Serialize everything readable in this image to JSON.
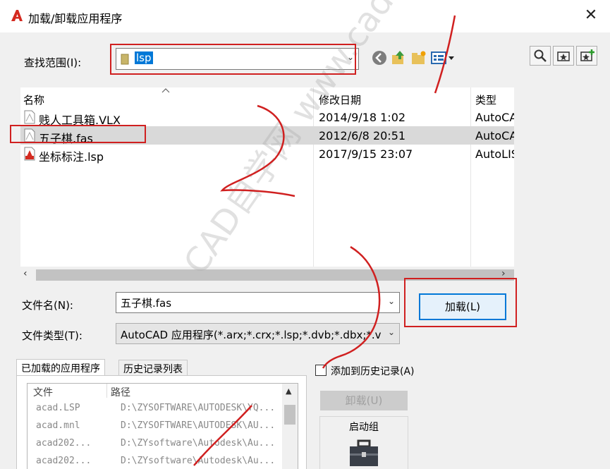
{
  "window": {
    "title": "加载/卸载应用程序",
    "close_glyph": "✕"
  },
  "lookin": {
    "label": "查找范围(I):",
    "value": "lsp"
  },
  "filelist": {
    "headers": {
      "name": "名称",
      "date": "修改日期",
      "type": "类型"
    },
    "rows": [
      {
        "name": "贱人工具箱.VLX",
        "date": "2014/9/18 1:02",
        "type": "AutoCA",
        "icon": "vlx-file-icon"
      },
      {
        "name": "五子棋.fas",
        "date": "2012/6/8 20:51",
        "type": "AutoCA",
        "icon": "fas-file-icon"
      },
      {
        "name": "坐标标注.lsp",
        "date": "2017/9/15 23:07",
        "type": "AutoLIS",
        "icon": "lsp-file-icon"
      }
    ]
  },
  "filename": {
    "label": "文件名(N):",
    "value": "五子棋.fas"
  },
  "filetype": {
    "label": "文件类型(T):",
    "value": "AutoCAD 应用程序(*.arx;*.crx;*.lsp;*.dvb;*.dbx;*.v"
  },
  "buttons": {
    "load": "加载(L)",
    "unload": "卸载(U)"
  },
  "tabs": {
    "loaded": "已加载的应用程序",
    "history": "历史记录列表"
  },
  "applist": {
    "headers": {
      "file": "文件",
      "path": "路径"
    },
    "rows": [
      {
        "file": "acad.LSP",
        "path": "D:\\ZYSOFTWARE\\AUTODESK\\YQ..."
      },
      {
        "file": "acad.mnl",
        "path": "D:\\ZYSOFTWARE\\AUTODESK\\AU..."
      },
      {
        "file": "acad202...",
        "path": "D:\\ZYsoftware\\Autodesk\\Au..."
      },
      {
        "file": "acad202...",
        "path": "D:\\ZYsoftware\\Autodesk\\Au..."
      }
    ]
  },
  "history_checkbox": {
    "label": "添加到历史记录(A)"
  },
  "startup": {
    "label": "启动组"
  },
  "watermark": {
    "text": "CAD自学网 www.cadzxw.com"
  },
  "colors": {
    "accent": "#0078d7",
    "annotation_red": "#d02020",
    "selected_row": "#d9d9d9"
  }
}
